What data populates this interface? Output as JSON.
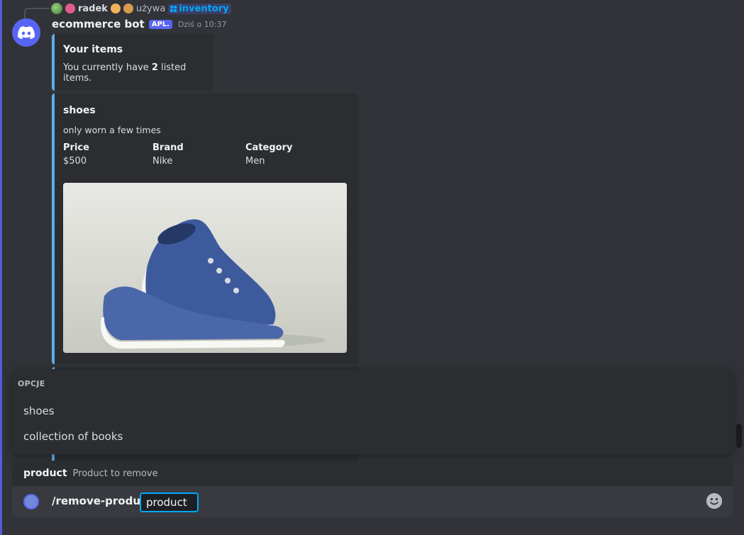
{
  "reply": {
    "user": "radek",
    "using_text": "używa",
    "command": "inventory"
  },
  "message": {
    "author": "ecommerce bot",
    "app_tag": "APL.",
    "timestamp": "Dziś o 10:37"
  },
  "embed_summary": {
    "title": "Your items",
    "desc_prefix": "You currently have ",
    "count": "2",
    "desc_suffix": " listed items."
  },
  "embed_item": {
    "title": "shoes",
    "description": "only worn a few times",
    "fields": [
      {
        "name": "Price",
        "value": "$500"
      },
      {
        "name": "Brand",
        "value": "Nike"
      },
      {
        "name": "Category",
        "value": "Men"
      }
    ]
  },
  "autocomplete": {
    "heading": "OPCJE",
    "options": [
      "shoes",
      "collection of books"
    ]
  },
  "option_hint": {
    "name": "product",
    "description": "Product to remove"
  },
  "composer": {
    "command": "/remove-product",
    "param_value": "product"
  },
  "colors": {
    "accent": "#5865f2",
    "embed_border": "#5dadec",
    "link": "#00a8fc",
    "background": "#313338"
  },
  "icons": {
    "avatar": "discord-logo-icon",
    "emoji_button": "smiley-icon"
  }
}
